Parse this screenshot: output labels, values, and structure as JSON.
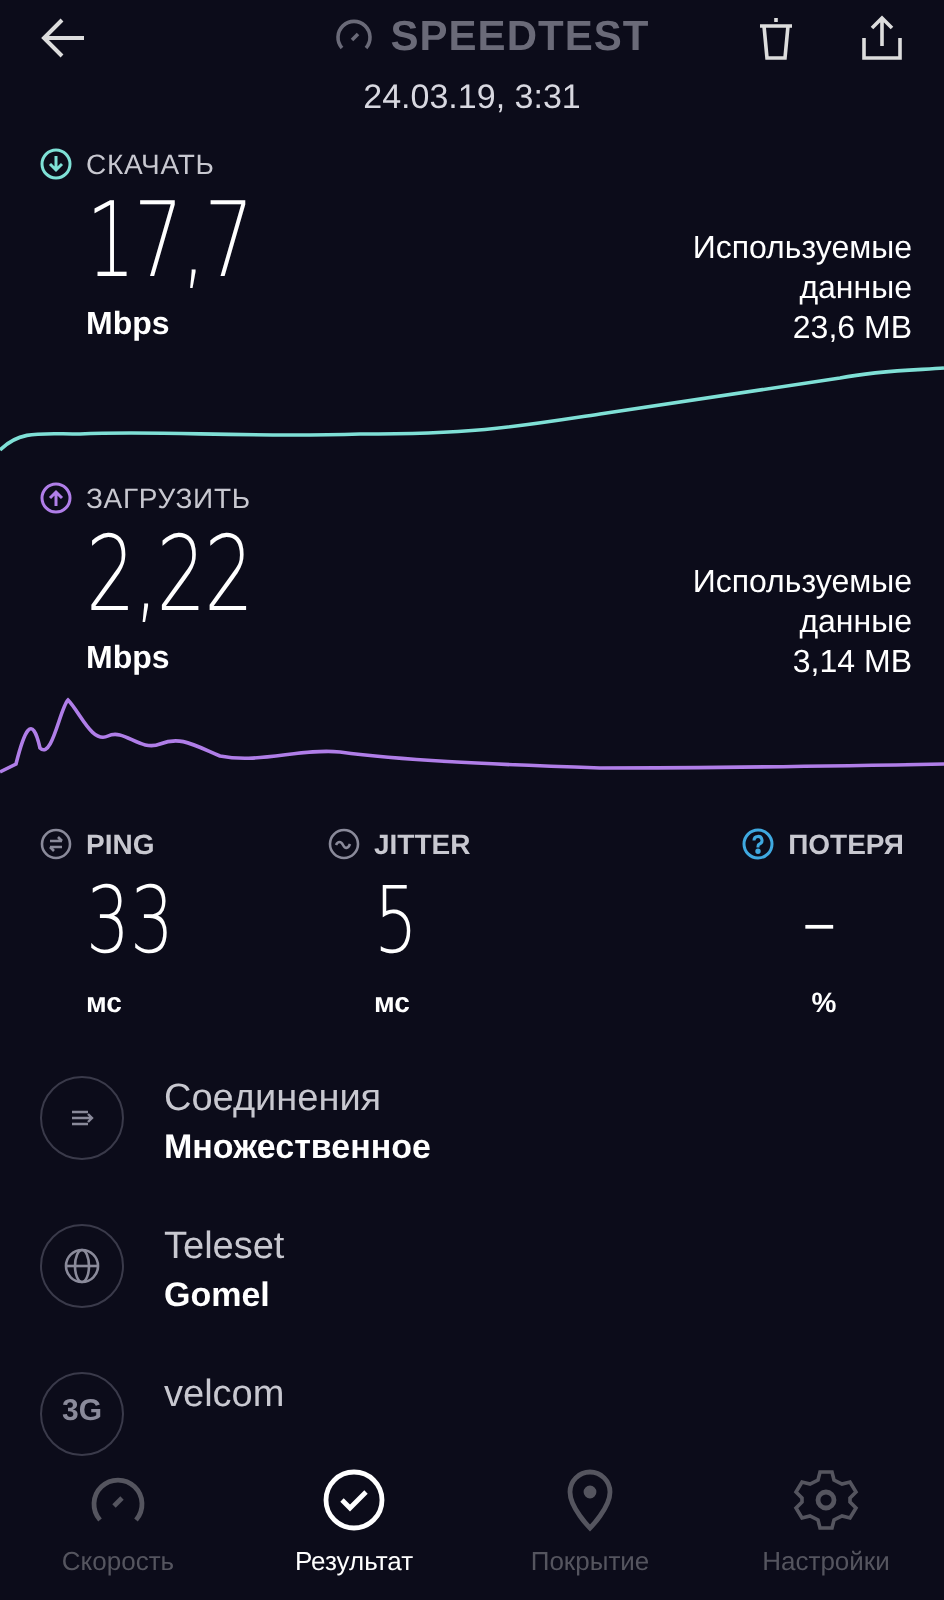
{
  "header": {
    "title": "SPEEDTEST",
    "datetime": "24.03.19, 3:31"
  },
  "transfers": [
    {
      "kind": "download",
      "label": "СКАЧАТЬ",
      "value": "17,7",
      "unit": "Mbps",
      "data_label": "Используемые данные",
      "data_value": "23,6 MB",
      "color": "#7fe0d6"
    },
    {
      "kind": "upload",
      "label": "ЗАГРУЗИТЬ",
      "value": "2,22",
      "unit": "Mbps",
      "data_label": "Используемые данные",
      "data_value": "3,14 MB",
      "color": "#b07ee8"
    }
  ],
  "metrics": [
    {
      "kind": "ping",
      "label": "PING",
      "value": "33",
      "unit": "мс"
    },
    {
      "kind": "jitter",
      "label": "JITTER",
      "value": "5",
      "unit": "мс"
    },
    {
      "kind": "loss",
      "label": "ПОТЕРЯ",
      "value": "–",
      "unit": "%"
    }
  ],
  "details": [
    {
      "kind": "connections",
      "title": "Соединения",
      "subtitle": "Множественное"
    },
    {
      "kind": "server",
      "title": "Teleset",
      "subtitle": "Gomel"
    },
    {
      "kind": "network",
      "badge": "3G",
      "title": "velcom"
    }
  ],
  "nav": [
    {
      "kind": "speed",
      "label": "Скорость",
      "selected": false
    },
    {
      "kind": "result",
      "label": "Результат",
      "selected": true
    },
    {
      "kind": "coverage",
      "label": "Покрытие",
      "selected": false
    },
    {
      "kind": "settings",
      "label": "Настройки",
      "selected": false
    }
  ]
}
